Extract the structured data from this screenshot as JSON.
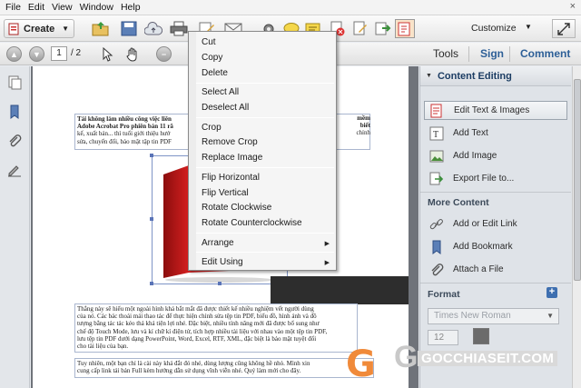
{
  "menubar": {
    "items": [
      "File",
      "Edit",
      "View",
      "Window",
      "Help"
    ],
    "close": "×"
  },
  "toolbar": {
    "create_label": "Create",
    "customize_label": "Customize"
  },
  "nav": {
    "page_current": "1",
    "page_total": "/ 2"
  },
  "tabs": {
    "tools": "Tools",
    "sign": "Sign",
    "comment": "Comment"
  },
  "context_menu": {
    "cut": "Cut",
    "copy": "Copy",
    "delete": "Delete",
    "select_all": "Select All",
    "deselect_all": "Deselect All",
    "crop": "Crop",
    "remove_crop": "Remove Crop",
    "replace_image": "Replace Image",
    "flip_horizontal": "Flip Horizontal",
    "flip_vertical": "Flip Vertical",
    "rotate_clockwise": "Rotate Clockwise",
    "rotate_counterclockwise": "Rotate Counterclockwise",
    "arrange": "Arrange",
    "edit_using": "Edit Using"
  },
  "right_panel": {
    "content_editing_title": "Content Editing",
    "edit_text_images": "Edit Text & Images",
    "add_text": "Add Text",
    "add_image": "Add Image",
    "export_file": "Export File to...",
    "more_content_title": "More Content",
    "add_edit_link": "Add or Edit Link",
    "add_bookmark": "Add Bookmark",
    "attach_file": "Attach a File",
    "format_title": "Format",
    "font_name": "Times New Roman",
    "font_size": "12"
  },
  "document": {
    "para1": [
      "Tải không làm nhiều công việc liên",
      "Adobe Acrobat Pro phiên bản 11 rã",
      "kế, xuất bản... thì tuổi giới thiệu hướ",
      "sửa, chuyển đổi, bảo mật tập tin PDF"
    ],
    "para1_right": [
      " mềm",
      " biết",
      " chỉnh",
      ""
    ],
    "para2": [
      "Thắng này sẽ hiểu một ngoài hình khá bắt mắt đã được thiết kế nhiều nghiệm vết người dùng",
      "của nó. Các bác thoải mái thao tác để thực hiện chỉnh sửa tệp tin PDF, biểu đồ, hình ảnh và đồ",
      "tượng bằng tác tác kéo thả khá tiện lợi nhé. Đặc biệt, nhiều tính năng mới đã được bổ sung như",
      "chế độ Touch Mode, lưu và kí chữ kí điện tử, tích hợp nhiều tài liệu với nhau vào một tệp tin PDF,",
      "lưu tệp tin PDF dưới dạng PowerPoint, Word, Excel, RTF, XML, đặc biệt là bảo mật tuyệt đối",
      "cho tài liệu của bạn."
    ],
    "para3": [
      "Tuy nhiên, một bạn chỉ là cài này khá đắt đó nhé, dùng lượng cũng không hề nhỏ. Mình xin",
      "cung cấp link tải bản Full kèm hướng dẫn sử dụng vĩnh viễn nhé. Quý làm mới cho đây."
    ]
  },
  "watermark": {
    "text": "GOCCHIASEIT.COM"
  },
  "colors": {
    "accent": "#2d5f97",
    "panel_header": "#1c3d63",
    "doc_bg": "#6f737a"
  }
}
